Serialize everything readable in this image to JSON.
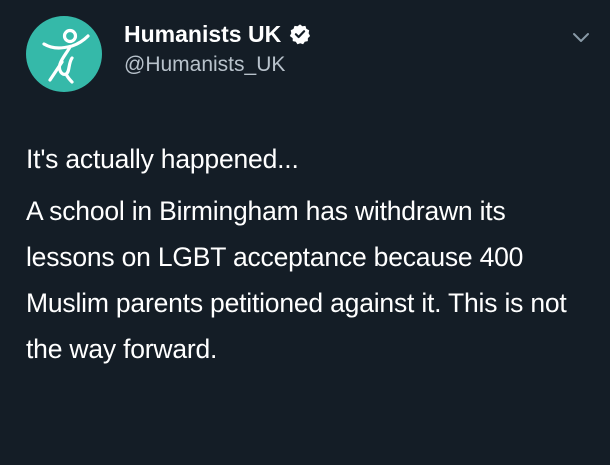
{
  "account": {
    "display_name": "Humanists UK",
    "handle": "@Humanists_UK",
    "verified": true,
    "avatar_icon": "humanist-figure-logo",
    "avatar_color": "#35b9a9"
  },
  "menu": {
    "icon": "chevron-down-icon"
  },
  "tweet": {
    "paragraphs": [
      "It's actually happened...",
      "A school in Birmingham has withdrawn its lessons on LGBT acceptance because 400 Muslim parents petitioned against it. This is not the way forward."
    ]
  },
  "colors": {
    "background": "#141d26",
    "text": "#ffffff",
    "secondary_text": "#b8c2cb",
    "verified_badge": "#ffffff"
  }
}
